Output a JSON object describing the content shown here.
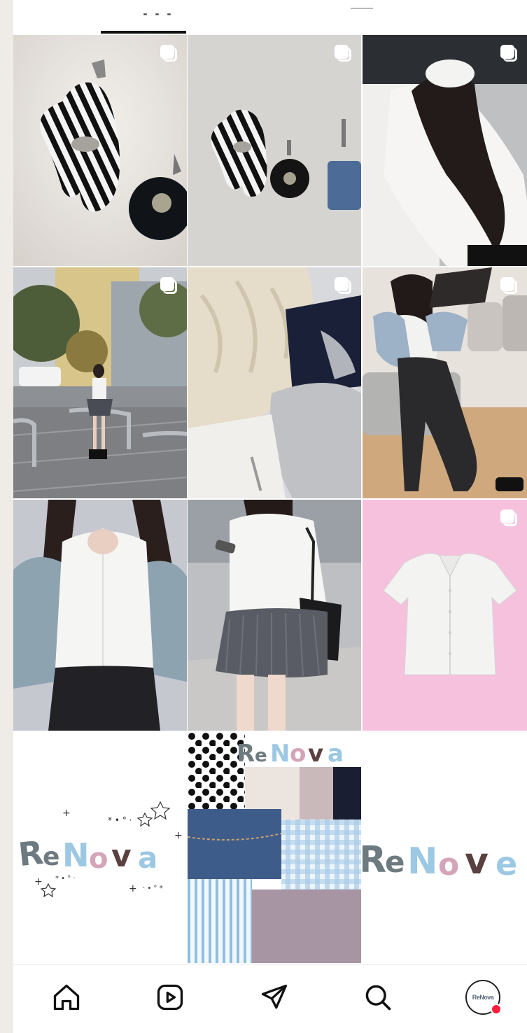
{
  "tabs": [
    {
      "name": "grid",
      "active": true
    },
    {
      "name": "tagged",
      "active": false
    }
  ],
  "posts": [
    {
      "id": "keychain-closeup",
      "multi": true
    },
    {
      "id": "keychains-row",
      "multi": true
    },
    {
      "id": "scrunchie-hair",
      "multi": true
    },
    {
      "id": "street-outfit",
      "multi": true
    },
    {
      "id": "knit-and-bag",
      "multi": true
    },
    {
      "id": "reading-sofa",
      "multi": true
    },
    {
      "id": "white-shirt-cardigan",
      "multi": false
    },
    {
      "id": "pleated-skirt-outfit",
      "multi": false
    },
    {
      "id": "white-blouse-pink",
      "multi": true
    },
    {
      "id": "renova-logo-stars",
      "multi": false,
      "logo_text": "ReNova"
    },
    {
      "id": "renova-fabric-collage",
      "multi": false,
      "logo_text": "ReNova"
    },
    {
      "id": "renova-logo-cropped",
      "multi": false,
      "logo_text": "ReNove"
    }
  ],
  "bottom_nav": {
    "items": [
      "home-icon",
      "reels-icon",
      "send-icon",
      "search-icon",
      "profile-avatar"
    ],
    "avatar_text": "ReNova",
    "notification": true
  },
  "colors": {
    "accent_dot": "#ff1f3d",
    "pink_bg": "#f6c1dd",
    "logo_gray": "#6d7a7f",
    "logo_blue": "#9cc8e3",
    "logo_pink": "#d4a4b8",
    "logo_brown": "#5a4140"
  }
}
